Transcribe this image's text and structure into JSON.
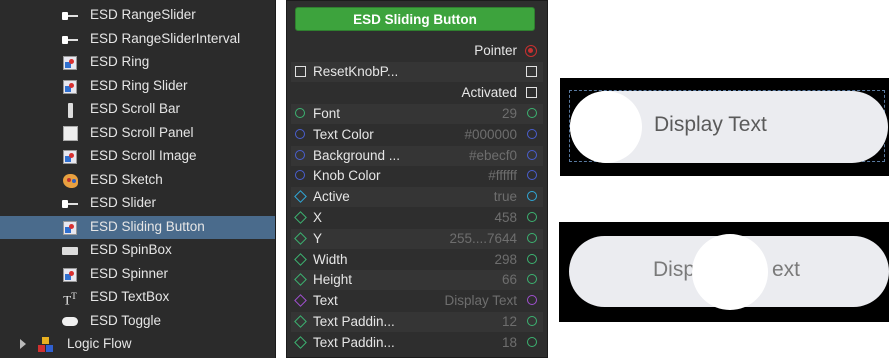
{
  "tree": {
    "items": [
      {
        "label": "ESD RangeSlider",
        "icon": "range-slider-icon"
      },
      {
        "label": "ESD RangeSliderInterval",
        "icon": "range-slider-interval-icon"
      },
      {
        "label": "ESD Ring",
        "icon": "ring-icon"
      },
      {
        "label": "ESD Ring Slider",
        "icon": "ring-slider-icon"
      },
      {
        "label": "ESD Scroll Bar",
        "icon": "scroll-bar-icon"
      },
      {
        "label": "ESD Scroll Panel",
        "icon": "scroll-panel-icon"
      },
      {
        "label": "ESD Scroll Image",
        "icon": "scroll-image-icon"
      },
      {
        "label": "ESD Sketch",
        "icon": "sketch-icon"
      },
      {
        "label": "ESD Slider",
        "icon": "slider-icon"
      },
      {
        "label": "ESD Sliding Button",
        "icon": "sliding-button-icon",
        "selected": true
      },
      {
        "label": "ESD SpinBox",
        "icon": "spinbox-icon"
      },
      {
        "label": "ESD Spinner",
        "icon": "spinner-icon"
      },
      {
        "label": "ESD TextBox",
        "icon": "textbox-icon"
      },
      {
        "label": "ESD Toggle",
        "icon": "toggle-icon"
      }
    ],
    "root": {
      "label": "Logic Flow",
      "icon": "logic-flow-icon"
    },
    "selected_color": "#4a6b8c"
  },
  "node": {
    "title": "ESD Sliding Button",
    "title_color": "#3da33d",
    "pointer_label": "Pointer",
    "reset_label": "ResetKnobP...",
    "activated_label": "Activated",
    "props": [
      {
        "name": "Font",
        "value": "29",
        "pin": "circle",
        "color": "#3cb371"
      },
      {
        "name": "Text Color",
        "value": "#000000",
        "pin": "circle",
        "color": "#4a5fd0"
      },
      {
        "name": "Background ...",
        "value": "#ebecf0",
        "pin": "circle",
        "color": "#4a5fd0"
      },
      {
        "name": "Knob Color",
        "value": "#ffffff",
        "pin": "circle",
        "color": "#4a5fd0"
      },
      {
        "name": "Active",
        "value": "true",
        "pin": "diamond",
        "color": "#30a8d8"
      },
      {
        "name": "X",
        "value": "458",
        "pin": "diamond",
        "color": "#3cb371"
      },
      {
        "name": "Y",
        "value": "255....7644",
        "pin": "diamond",
        "color": "#3cb371"
      },
      {
        "name": "Width",
        "value": "298",
        "pin": "diamond",
        "color": "#3cb371"
      },
      {
        "name": "Height",
        "value": "66",
        "pin": "diamond",
        "color": "#3cb371"
      },
      {
        "name": "Text",
        "value": "Display Text",
        "pin": "diamond",
        "color": "#a050d0"
      },
      {
        "name": "Text Paddin...",
        "value": "12",
        "pin": "diamond",
        "color": "#3cb371"
      },
      {
        "name": "Text Paddin...",
        "value": "18",
        "pin": "diamond",
        "color": "#3cb371"
      }
    ]
  },
  "preview": {
    "off_text": "Display Text",
    "on_text_left": "Disp",
    "on_text_right": "ext",
    "pill_color": "#ebecf0",
    "knob_color": "#ffffff"
  }
}
